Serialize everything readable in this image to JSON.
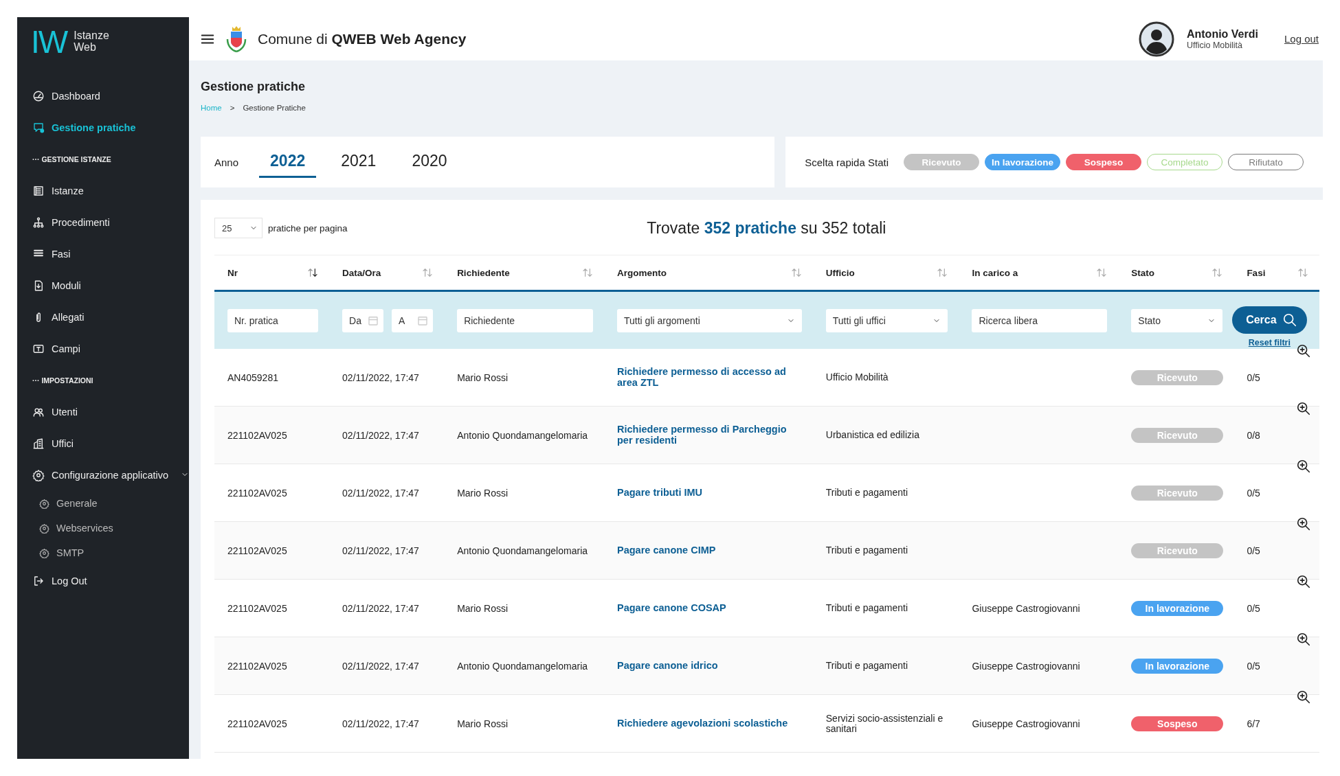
{
  "sidebar": {
    "logo": {
      "mark": "IW",
      "name": "Istanze Web"
    },
    "items": [
      {
        "kind": "link",
        "label": "Dashboard",
        "selected": false
      },
      {
        "kind": "link",
        "label": "Gestione pratiche",
        "selected": true
      },
      {
        "kind": "section",
        "label": "··· GESTIONE ISTANZE"
      },
      {
        "kind": "link",
        "label": "Istanze",
        "selected": false
      },
      {
        "kind": "link",
        "label": "Procedimenti",
        "selected": false
      },
      {
        "kind": "link",
        "label": "Fasi",
        "selected": false
      },
      {
        "kind": "link",
        "label": "Moduli",
        "selected": false
      },
      {
        "kind": "link",
        "label": "Allegati",
        "selected": false
      },
      {
        "kind": "link",
        "label": "Campi",
        "selected": false
      },
      {
        "kind": "section",
        "label": "··· IMPOSTAZIONI"
      },
      {
        "kind": "link",
        "label": "Utenti",
        "selected": false
      },
      {
        "kind": "link",
        "label": "Uffici",
        "selected": false
      },
      {
        "kind": "group",
        "label": "Configurazione applicativo",
        "expanded": true,
        "children": [
          {
            "label": "Generale",
            "selected": false
          },
          {
            "label": "Webservices",
            "selected": false
          },
          {
            "label": "SMTP",
            "selected": false
          }
        ]
      },
      {
        "kind": "link",
        "label": "Log Out",
        "selected": false
      }
    ]
  },
  "header": {
    "title": "Comune di **QWEB Web Agency**",
    "user": {
      "name": "Antonio Verdi",
      "office": "Ufficio Mobilità"
    },
    "logout": "Log out"
  },
  "page": {
    "title": "Gestione pratiche",
    "breadcrumb": [
      "Home",
      "Gestione Pratiche"
    ],
    "breadcrumb_separator": ">"
  },
  "year_filter": {
    "label": "Anno",
    "years": [
      {
        "label": "2022",
        "selected": true
      },
      {
        "label": "2021",
        "selected": false
      },
      {
        "label": "2020",
        "selected": false
      }
    ]
  },
  "quick_states": {
    "label": "Scelta rapida Stati",
    "items": [
      {
        "label": "Ricevuto",
        "kind": "filled",
        "color": "#c4c4c4"
      },
      {
        "label": "In lavorazione",
        "kind": "filled",
        "color": "#4aa3f0"
      },
      {
        "label": "Sospeso",
        "kind": "filled",
        "color": "#f0616b"
      },
      {
        "label": "Completato",
        "kind": "outline",
        "color": "#a6d98c"
      },
      {
        "label": "Rifiutato",
        "kind": "outline",
        "color": "#7a7a7a"
      }
    ]
  },
  "results": {
    "page_size": "25",
    "page_size_label": "pratiche per pagina",
    "summary": "Trovate **352 pratiche** su 352 totali"
  },
  "table": {
    "columns": [
      {
        "label": "Nr",
        "sorted": true
      },
      {
        "label": "Data/Ora",
        "sorted": false
      },
      {
        "label": "Richiedente",
        "sorted": false
      },
      {
        "label": "Argomento",
        "sorted": false
      },
      {
        "label": "Ufficio",
        "sorted": false
      },
      {
        "label": "In carico a",
        "sorted": false
      },
      {
        "label": "Stato",
        "sorted": false
      },
      {
        "label": "Fasi",
        "sorted": false
      }
    ],
    "filters": {
      "number": {
        "placeholder": "Nr. pratica"
      },
      "date_from": {
        "placeholder": "Da"
      },
      "date_to": {
        "placeholder": "A"
      },
      "applicant": {
        "placeholder": "Richiedente"
      },
      "topic": {
        "value": "Tutti gli argomenti"
      },
      "office": {
        "value": "Tutti gli uffici"
      },
      "assignee": {
        "placeholder": "Ricerca libera"
      },
      "state": {
        "value": "Stato"
      },
      "search_button": "Cerca",
      "reset": "Reset filtri"
    },
    "rows": [
      {
        "nr": "AN4059281",
        "date": "02/11/2022, 17:47",
        "applicant": "Mario Rossi",
        "topic": "Richiedere permesso di accesso ad area ZTL",
        "office": "Ufficio Mobilità",
        "assignee": "",
        "status": {
          "label": "Ricevuto",
          "color": "#c4c4c4"
        },
        "phases": "0/5"
      },
      {
        "nr": "221102AV025",
        "date": "02/11/2022, 17:47",
        "applicant": "Antonio Quondamangelomaria",
        "topic": "Richiedere permesso di Parcheggio per residenti",
        "office": "Urbanistica ed edilizia",
        "assignee": "",
        "status": {
          "label": "Ricevuto",
          "color": "#c4c4c4"
        },
        "phases": "0/8"
      },
      {
        "nr": "221102AV025",
        "date": "02/11/2022, 17:47",
        "applicant": "Mario Rossi",
        "topic": "Pagare tributi IMU",
        "office": "Tributi e pagamenti",
        "assignee": "",
        "status": {
          "label": "Ricevuto",
          "color": "#c4c4c4"
        },
        "phases": "0/5"
      },
      {
        "nr": "221102AV025",
        "date": "02/11/2022, 17:47",
        "applicant": "Antonio Quondamangelomaria",
        "topic": "Pagare canone CIMP",
        "office": "Tributi e pagamenti",
        "assignee": "",
        "status": {
          "label": "Ricevuto",
          "color": "#c4c4c4"
        },
        "phases": "0/5"
      },
      {
        "nr": "221102AV025",
        "date": "02/11/2022, 17:47",
        "applicant": "Mario Rossi",
        "topic": "Pagare canone COSAP",
        "office": "Tributi e pagamenti",
        "assignee": "Giuseppe Castrogiovanni",
        "status": {
          "label": "In lavorazione",
          "color": "#4aa3f0"
        },
        "phases": "0/5"
      },
      {
        "nr": "221102AV025",
        "date": "02/11/2022, 17:47",
        "applicant": "Antonio Quondamangelomaria",
        "topic": "Pagare canone idrico",
        "office": "Tributi e pagamenti",
        "assignee": "Giuseppe Castrogiovanni",
        "status": {
          "label": "In lavorazione",
          "color": "#4aa3f0"
        },
        "phases": "0/5"
      },
      {
        "nr": "221102AV025",
        "date": "02/11/2022, 17:47",
        "applicant": "Mario Rossi",
        "topic": "Richiedere agevolazioni scolastiche",
        "office": "Servizi socio-assistenziali e sanitari",
        "assignee": "Giuseppe Castrogiovanni",
        "status": {
          "label": "Sospeso",
          "color": "#f0616b"
        },
        "phases": "6/7"
      }
    ]
  }
}
